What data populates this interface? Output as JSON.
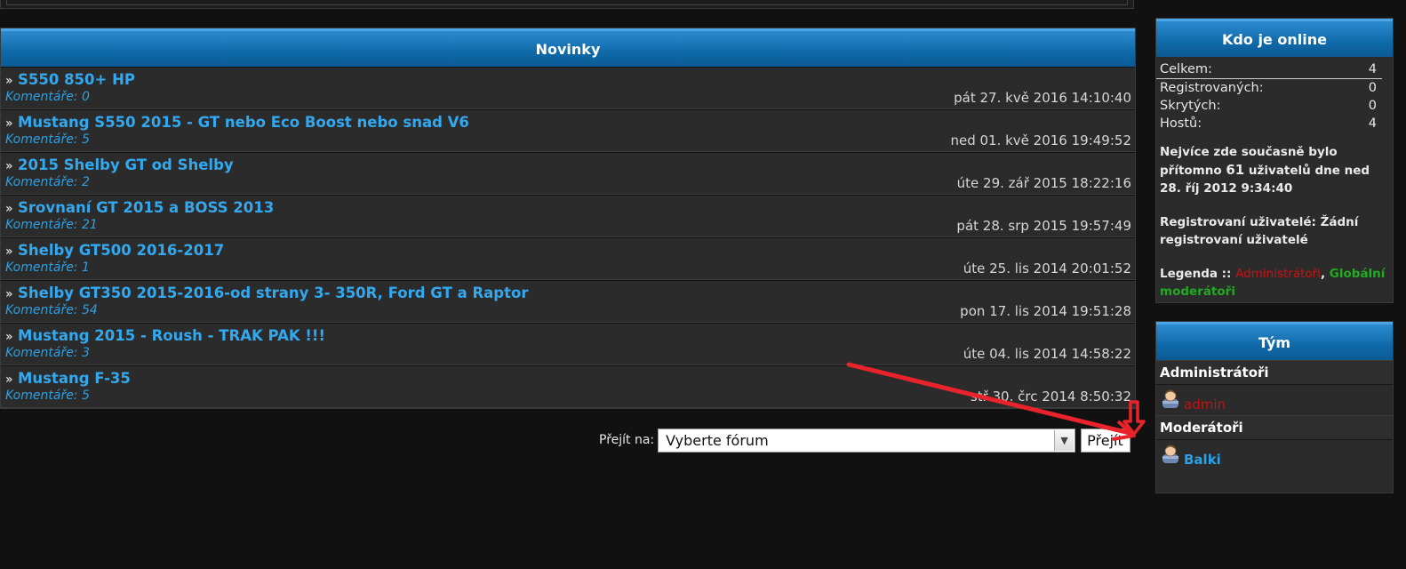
{
  "news": {
    "header": "Novinky",
    "items": [
      {
        "title": "S550 850+ HP",
        "comments": "Komentáře: 0",
        "date": "pát 27. kvě 2016 14:10:40"
      },
      {
        "title": "Mustang S550 2015 - GT nebo Eco Boost nebo snad V6",
        "comments": "Komentáře: 5",
        "date": "ned 01. kvě 2016 19:49:52"
      },
      {
        "title": "2015 Shelby GT od Shelby",
        "comments": "Komentáře: 2",
        "date": "úte 29. zář 2015 18:22:16"
      },
      {
        "title": "Srovnaní GT 2015 a BOSS 2013",
        "comments": "Komentáře: 21",
        "date": "pát 28. srp 2015 19:57:49"
      },
      {
        "title": "Shelby GT500 2016-2017",
        "comments": "Komentáře: 1",
        "date": "úte 25. lis 2014 20:01:52"
      },
      {
        "title": "Shelby GT350 2015-2016-od strany 3- 350R, Ford GT a Raptor",
        "comments": "Komentáře: 54",
        "date": "pon 17. lis 2014 19:51:28"
      },
      {
        "title": "Mustang 2015 - Roush - TRAK PAK !!!",
        "comments": "Komentáře: 3",
        "date": "úte 04. lis 2014 14:58:22"
      },
      {
        "title": "Mustang F-35",
        "comments": "Komentáře: 5",
        "date": "stř 30. črc 2014 8:50:32"
      }
    ]
  },
  "jump": {
    "label": "Přejít na:",
    "selected": "Vyberte fórum",
    "button": "Přejít"
  },
  "online": {
    "header": "Kdo je online",
    "stats": [
      {
        "label": "Celkem:",
        "value": "4"
      },
      {
        "label": "Registrovaných:",
        "value": "0"
      },
      {
        "label": "Skrytých:",
        "value": "0"
      },
      {
        "label": "Hostů:",
        "value": "4"
      }
    ],
    "record_pre": "Nejvíce zde současně bylo přítomno",
    "record_count": "61",
    "record_post": "uživatelů dne ned 28. říj 2012 9:34:40",
    "registered_label": "Registrovaní uživatelé:",
    "registered_value": "Žádní registrovaní uživatelé",
    "legend_label": "Legenda ::",
    "legend_admin": "Administrátoři",
    "legend_sep": ",",
    "legend_global": "Globální moderátoři"
  },
  "team": {
    "header": "Tým",
    "admins_label": "Administrátoři",
    "admin_name": "admin",
    "mods_label": "Moderátoři",
    "mod_name": "Balki"
  },
  "colors": {
    "header_blue": "#0f69a8",
    "link_blue": "#33a8ee",
    "admin_red": "#cc1111",
    "global_green": "#22aa22",
    "annotation_red": "#e8232b"
  }
}
